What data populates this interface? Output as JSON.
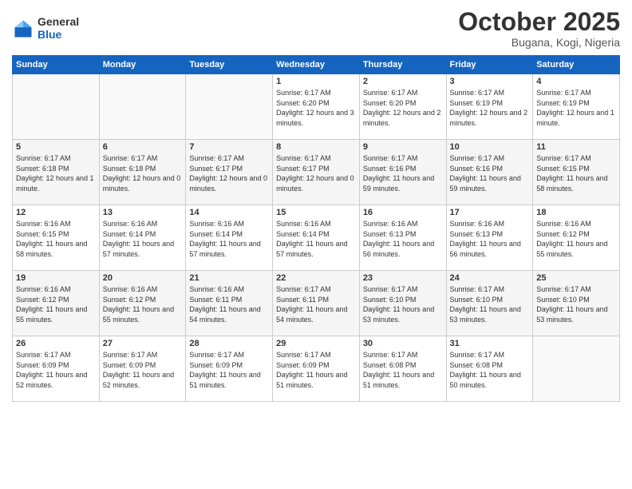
{
  "logo": {
    "general": "General",
    "blue": "Blue"
  },
  "header": {
    "title": "October 2025",
    "subtitle": "Bugana, Kogi, Nigeria"
  },
  "weekdays": [
    "Sunday",
    "Monday",
    "Tuesday",
    "Wednesday",
    "Thursday",
    "Friday",
    "Saturday"
  ],
  "weeks": [
    [
      {
        "day": "",
        "info": ""
      },
      {
        "day": "",
        "info": ""
      },
      {
        "day": "",
        "info": ""
      },
      {
        "day": "1",
        "info": "Sunrise: 6:17 AM\nSunset: 6:20 PM\nDaylight: 12 hours and 3 minutes."
      },
      {
        "day": "2",
        "info": "Sunrise: 6:17 AM\nSunset: 6:20 PM\nDaylight: 12 hours and 2 minutes."
      },
      {
        "day": "3",
        "info": "Sunrise: 6:17 AM\nSunset: 6:19 PM\nDaylight: 12 hours and 2 minutes."
      },
      {
        "day": "4",
        "info": "Sunrise: 6:17 AM\nSunset: 6:19 PM\nDaylight: 12 hours and 1 minute."
      }
    ],
    [
      {
        "day": "5",
        "info": "Sunrise: 6:17 AM\nSunset: 6:18 PM\nDaylight: 12 hours and 1 minute."
      },
      {
        "day": "6",
        "info": "Sunrise: 6:17 AM\nSunset: 6:18 PM\nDaylight: 12 hours and 0 minutes."
      },
      {
        "day": "7",
        "info": "Sunrise: 6:17 AM\nSunset: 6:17 PM\nDaylight: 12 hours and 0 minutes."
      },
      {
        "day": "8",
        "info": "Sunrise: 6:17 AM\nSunset: 6:17 PM\nDaylight: 12 hours and 0 minutes."
      },
      {
        "day": "9",
        "info": "Sunrise: 6:17 AM\nSunset: 6:16 PM\nDaylight: 11 hours and 59 minutes."
      },
      {
        "day": "10",
        "info": "Sunrise: 6:17 AM\nSunset: 6:16 PM\nDaylight: 11 hours and 59 minutes."
      },
      {
        "day": "11",
        "info": "Sunrise: 6:17 AM\nSunset: 6:15 PM\nDaylight: 11 hours and 58 minutes."
      }
    ],
    [
      {
        "day": "12",
        "info": "Sunrise: 6:16 AM\nSunset: 6:15 PM\nDaylight: 11 hours and 58 minutes."
      },
      {
        "day": "13",
        "info": "Sunrise: 6:16 AM\nSunset: 6:14 PM\nDaylight: 11 hours and 57 minutes."
      },
      {
        "day": "14",
        "info": "Sunrise: 6:16 AM\nSunset: 6:14 PM\nDaylight: 11 hours and 57 minutes."
      },
      {
        "day": "15",
        "info": "Sunrise: 6:16 AM\nSunset: 6:14 PM\nDaylight: 11 hours and 57 minutes."
      },
      {
        "day": "16",
        "info": "Sunrise: 6:16 AM\nSunset: 6:13 PM\nDaylight: 11 hours and 56 minutes."
      },
      {
        "day": "17",
        "info": "Sunrise: 6:16 AM\nSunset: 6:13 PM\nDaylight: 11 hours and 56 minutes."
      },
      {
        "day": "18",
        "info": "Sunrise: 6:16 AM\nSunset: 6:12 PM\nDaylight: 11 hours and 55 minutes."
      }
    ],
    [
      {
        "day": "19",
        "info": "Sunrise: 6:16 AM\nSunset: 6:12 PM\nDaylight: 11 hours and 55 minutes."
      },
      {
        "day": "20",
        "info": "Sunrise: 6:16 AM\nSunset: 6:12 PM\nDaylight: 11 hours and 55 minutes."
      },
      {
        "day": "21",
        "info": "Sunrise: 6:16 AM\nSunset: 6:11 PM\nDaylight: 11 hours and 54 minutes."
      },
      {
        "day": "22",
        "info": "Sunrise: 6:17 AM\nSunset: 6:11 PM\nDaylight: 11 hours and 54 minutes."
      },
      {
        "day": "23",
        "info": "Sunrise: 6:17 AM\nSunset: 6:10 PM\nDaylight: 11 hours and 53 minutes."
      },
      {
        "day": "24",
        "info": "Sunrise: 6:17 AM\nSunset: 6:10 PM\nDaylight: 11 hours and 53 minutes."
      },
      {
        "day": "25",
        "info": "Sunrise: 6:17 AM\nSunset: 6:10 PM\nDaylight: 11 hours and 53 minutes."
      }
    ],
    [
      {
        "day": "26",
        "info": "Sunrise: 6:17 AM\nSunset: 6:09 PM\nDaylight: 11 hours and 52 minutes."
      },
      {
        "day": "27",
        "info": "Sunrise: 6:17 AM\nSunset: 6:09 PM\nDaylight: 11 hours and 52 minutes."
      },
      {
        "day": "28",
        "info": "Sunrise: 6:17 AM\nSunset: 6:09 PM\nDaylight: 11 hours and 51 minutes."
      },
      {
        "day": "29",
        "info": "Sunrise: 6:17 AM\nSunset: 6:09 PM\nDaylight: 11 hours and 51 minutes."
      },
      {
        "day": "30",
        "info": "Sunrise: 6:17 AM\nSunset: 6:08 PM\nDaylight: 11 hours and 51 minutes."
      },
      {
        "day": "31",
        "info": "Sunrise: 6:17 AM\nSunset: 6:08 PM\nDaylight: 11 hours and 50 minutes."
      },
      {
        "day": "",
        "info": ""
      }
    ]
  ]
}
